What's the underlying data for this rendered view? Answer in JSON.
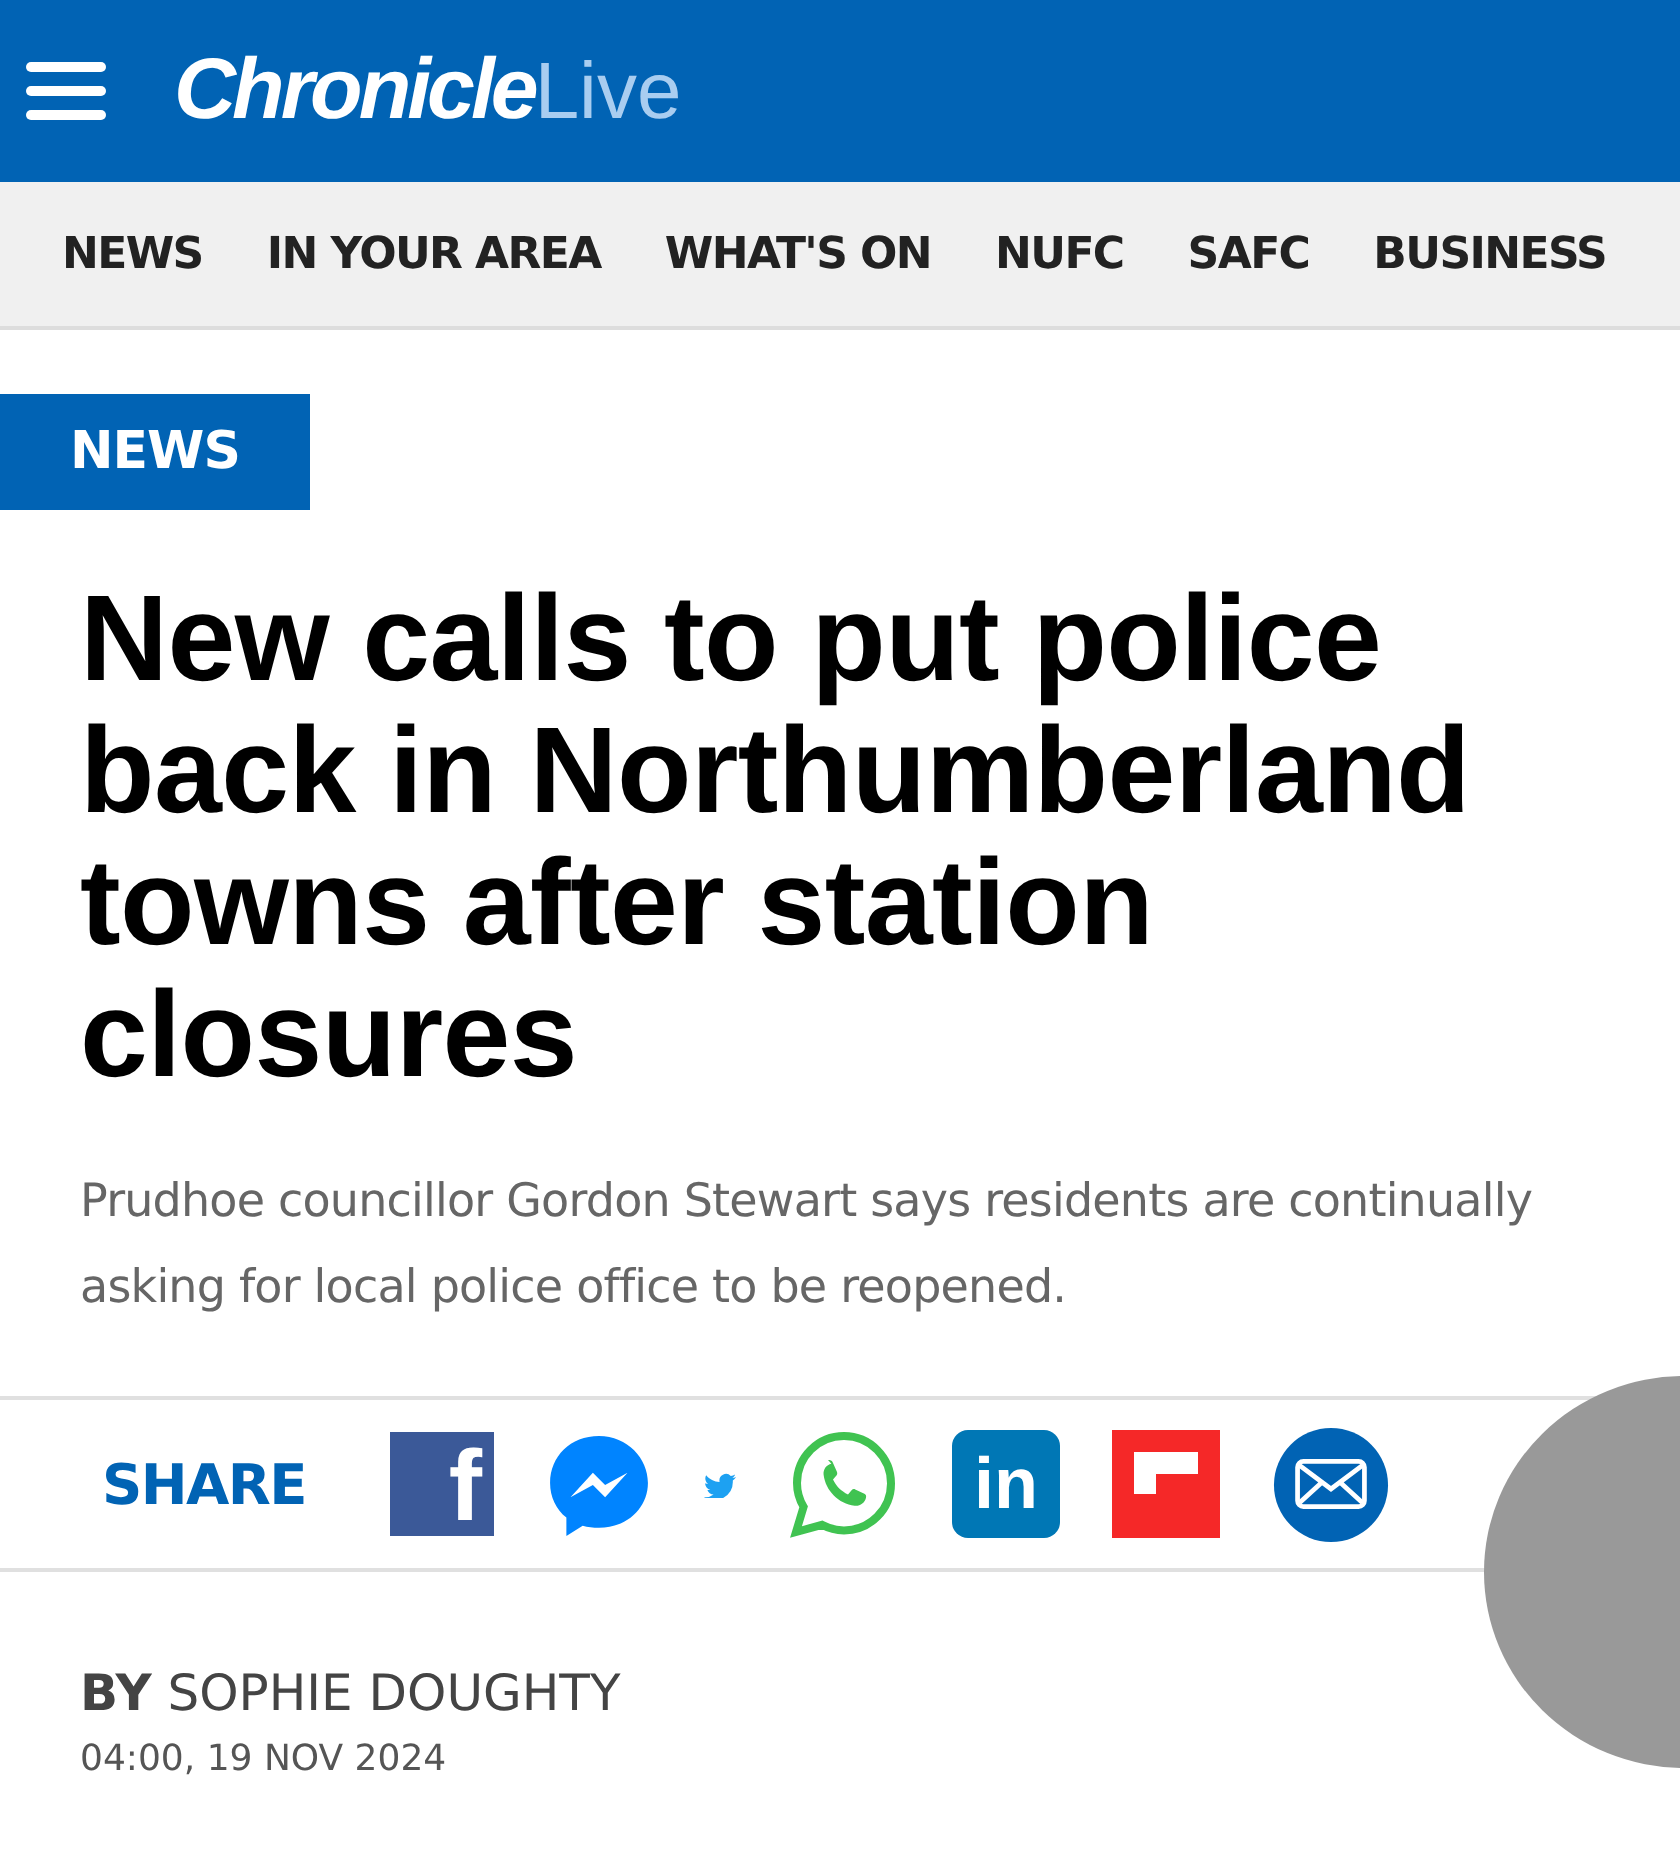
{
  "header": {
    "logo_main": "Chronicle",
    "logo_sub": "Live"
  },
  "nav": [
    {
      "label": "NEWS"
    },
    {
      "label": "IN YOUR AREA"
    },
    {
      "label": "WHAT'S ON"
    },
    {
      "label": "NUFC"
    },
    {
      "label": "SAFC"
    },
    {
      "label": "BUSINESS"
    }
  ],
  "article": {
    "category": "NEWS",
    "headline": "New calls to put police back in Northumberland towns after station closures",
    "standfirst": "Prudhoe councillor Gordon Stewart says residents are continually asking for local police office to be reopened.",
    "byline": "**BY** SOPHIE DOUGHTY",
    "date": "04:00, 19 NOV 2024"
  },
  "share": {
    "label": "SHARE",
    "buttons": [
      {
        "kind": "facebook",
        "glyph": "f"
      },
      {
        "kind": "messenger"
      },
      {
        "kind": "twitter"
      },
      {
        "kind": "whatsapp"
      },
      {
        "kind": "linkedin",
        "glyph": "in"
      },
      {
        "kind": "flipboard"
      },
      {
        "kind": "email"
      }
    ]
  }
}
